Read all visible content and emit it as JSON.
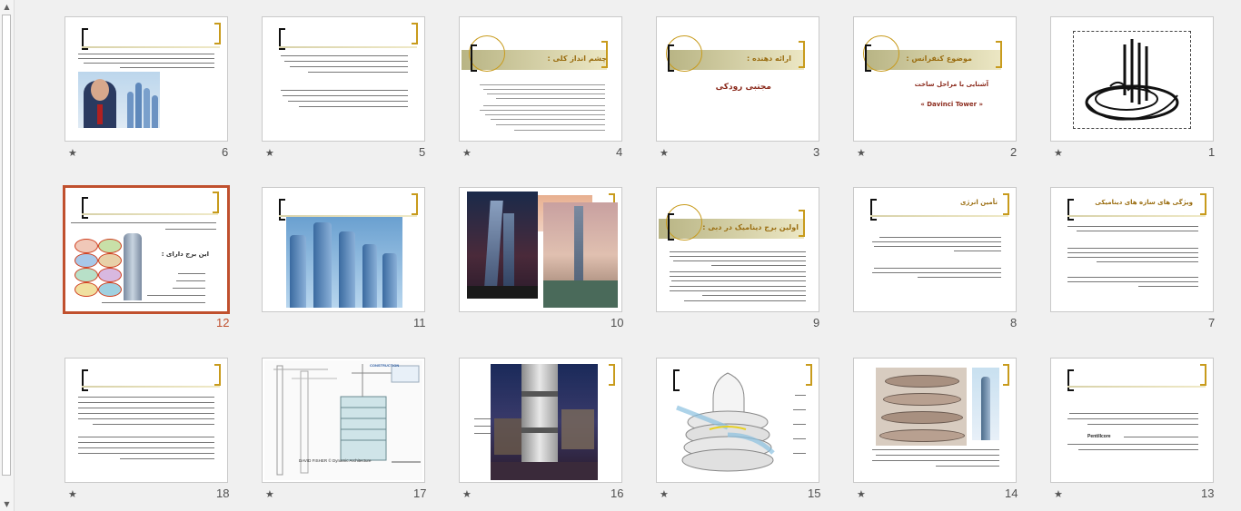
{
  "slides": [
    {
      "number": "1"
    },
    {
      "number": "2",
      "title": "موضوع کنفرانس :",
      "subtitle": "آشنایی با مراحل ساخت",
      "tower_name": "« Davinci Tower »"
    },
    {
      "number": "3",
      "label": "ارائه دهنده :",
      "presenter": "مجتبی رودکی"
    },
    {
      "number": "4",
      "title": "چشم انداز کلی :"
    },
    {
      "number": "5"
    },
    {
      "number": "6"
    },
    {
      "number": "7",
      "title": "ویژگی های سازه های دینامیکی"
    },
    {
      "number": "8",
      "title": "تأمین انرژی"
    },
    {
      "number": "9",
      "title": "اولین برج دینامیک در دبی :"
    },
    {
      "number": "10"
    },
    {
      "number": "11"
    },
    {
      "number": "12",
      "heading": "این برج دارای :"
    },
    {
      "number": "13",
      "latin_word": "Pentillcore"
    },
    {
      "number": "14"
    },
    {
      "number": "15"
    },
    {
      "number": "16"
    },
    {
      "number": "17",
      "drawing_caption": "DAVID FISHER ©    Dynamic Architecture",
      "drawing_header": "CONSTRUCTION"
    },
    {
      "number": "18"
    }
  ],
  "star_symbol": "★",
  "colors": {
    "accent": "#c89b1c",
    "selected": "#c0502e",
    "band": "#b8b484"
  }
}
